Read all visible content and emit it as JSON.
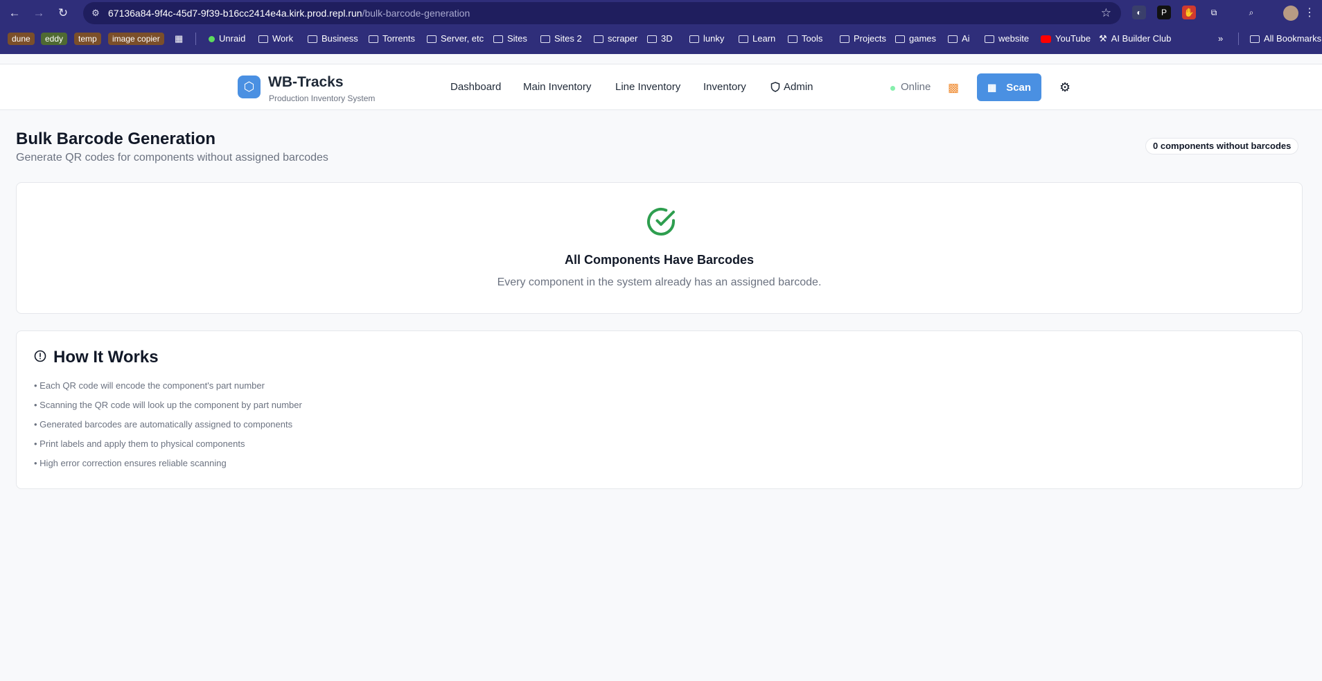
{
  "browser": {
    "url_host": "67136a84-9f4c-45d7-9f39-b16cc2414e4a.kirk.prod.repl.run",
    "url_path": "/bulk-barcode-generation",
    "bookmark_pills": [
      "dune",
      "eddy",
      "temp",
      "image copier"
    ],
    "bookmarks": [
      "Unraid",
      "Work",
      "Business",
      "Torrents",
      "Server, etc",
      "Sites",
      "Sites 2",
      "scraper",
      "3D",
      "lunky",
      "Learn",
      "Tools",
      "Projects",
      "games",
      "Ai",
      "website",
      "YouTube",
      "AI Builder Club"
    ],
    "all_bookmarks": "All Bookmarks",
    "overflow": "»"
  },
  "header": {
    "brand": "WB-Tracks",
    "tagline": "Production Inventory System",
    "nav": [
      "Dashboard",
      "Main Inventory",
      "Line Inventory",
      "Inventory",
      "Admin"
    ],
    "status": "Online",
    "scan_label": "Scan"
  },
  "page": {
    "title": "Bulk Barcode Generation",
    "subtitle": "Generate QR codes for components without assigned barcodes",
    "badge": "0 components without barcodes"
  },
  "done_card": {
    "title": "All Components Have Barcodes",
    "subtitle": "Every component in the system already has an assigned barcode."
  },
  "how_it_works": {
    "title": "How It Works",
    "items": [
      "• Each QR code will encode the component's part number",
      "• Scanning the QR code will look up the component by part number",
      "• Generated barcodes are automatically assigned to components",
      "• Print labels and apply them to physical components",
      "• High error correction ensures reliable scanning"
    ]
  },
  "colors": {
    "chrome": "#2f2e7a",
    "brand_blue": "#4a90e2",
    "success_green": "#2e9e4f",
    "qr_orange": "#f08c32"
  },
  "icons": [
    "back-icon",
    "forward-icon",
    "reload-icon",
    "site-info-icon",
    "star-icon",
    "cube-icon",
    "shield-icon",
    "qr-code-icon",
    "scan-icon",
    "gear-icon",
    "check-circle-icon",
    "alert-circle-icon"
  ]
}
